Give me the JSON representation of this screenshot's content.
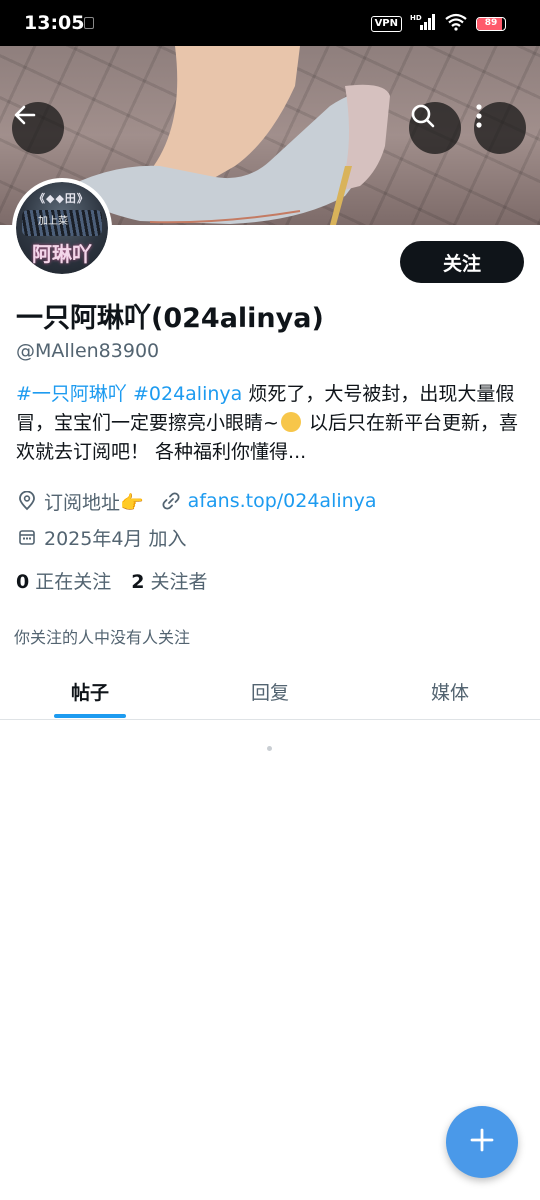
{
  "status_bar": {
    "time": "13:05",
    "vpn": "VPN",
    "network": "HD",
    "battery": "89"
  },
  "colors": {
    "accent": "#1d9bf0",
    "text_primary": "#0f1419",
    "text_secondary": "#536471",
    "fab": "#4a99e9"
  },
  "header": {
    "back_icon": "arrow-left-icon",
    "search_icon": "search-icon",
    "more_icon": "more-vertical-icon"
  },
  "profile": {
    "avatar_text_top": "《◆◆田》",
    "avatar_text_mid": "加上菜",
    "avatar_name": "阿琳吖",
    "follow_label": "关注",
    "display_name": "一只阿琳吖(024alinya)",
    "handle": "@MAllen83900",
    "bio": {
      "tag1": "#一只阿琳吖",
      "tag2": "#024alinya",
      "text1": " 烦死了，大号被封，出现大量假冒，宝宝们一定要擦亮小眼睛~",
      "text2": " 以后只在新平台更新，喜欢就去订阅吧！ 各种福利你懂得..."
    },
    "location": "订阅地址👉",
    "website": "afans.top/024alinya",
    "joined": "2025年4月 加入",
    "following_count": "0",
    "following_label": "正在关注",
    "followers_count": "2",
    "followers_label": "关注者",
    "followers_note": "你关注的人中没有人关注"
  },
  "tabs": [
    {
      "label": "帖子",
      "active": true
    },
    {
      "label": "回复",
      "active": false
    },
    {
      "label": "媒体",
      "active": false
    }
  ],
  "fab": {
    "icon": "plus-icon"
  }
}
